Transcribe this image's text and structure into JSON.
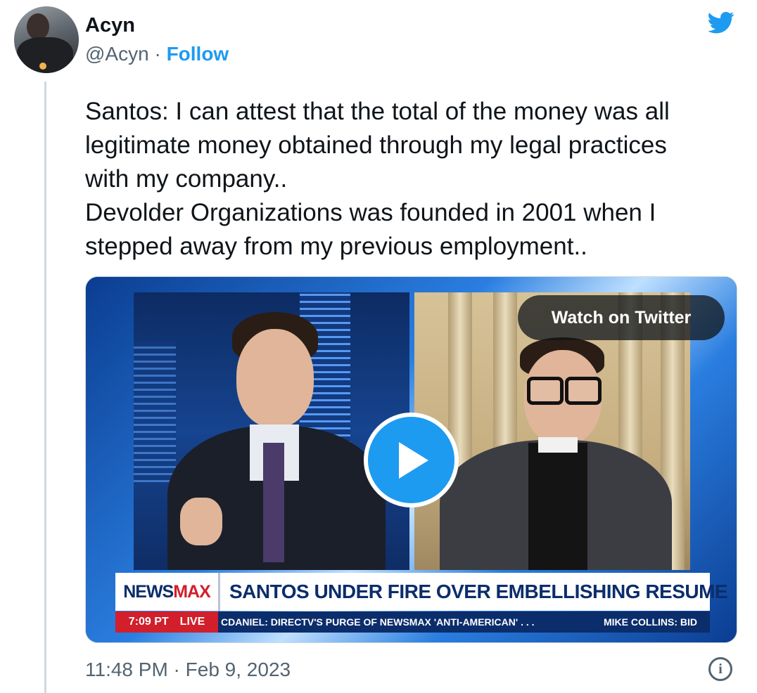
{
  "author": {
    "name": "Acyn",
    "handle": "@Acyn",
    "separator": "·",
    "follow_label": "Follow"
  },
  "icons": {
    "brand": "twitter-bird-icon",
    "play": "play-icon",
    "info": "info-icon"
  },
  "tweet": {
    "lines": [
      "Santos: I can attest that the total of the money was all",
      "legitimate money obtained through my legal practices",
      "with my company..",
      "Devolder Organizations was founded in 2001 when I",
      "stepped away from my previous employment.."
    ],
    "timestamp": "11:48 PM · Feb 9, 2023",
    "info_glyph": "i"
  },
  "media": {
    "watch_label": "Watch on Twitter",
    "broadcast": {
      "logo_part1": "NEWS",
      "logo_part2": "MAX",
      "headline": "SANTOS UNDER FIRE OVER EMBELLISHING RESUME",
      "time": "7:09 PT",
      "live": "LIVE",
      "ticker_1": "CDANIEL: DIRECTV'S PURGE OF NEWSMAX 'ANTI-AMERICAN' . . .",
      "ticker_2": "MIKE COLLINS: BID"
    }
  },
  "colors": {
    "accent": "#1d9bf0",
    "muted": "#536471",
    "text": "#0f1419",
    "newsmax_blue": "#0b2d6b",
    "newsmax_red": "#d11f2b"
  }
}
